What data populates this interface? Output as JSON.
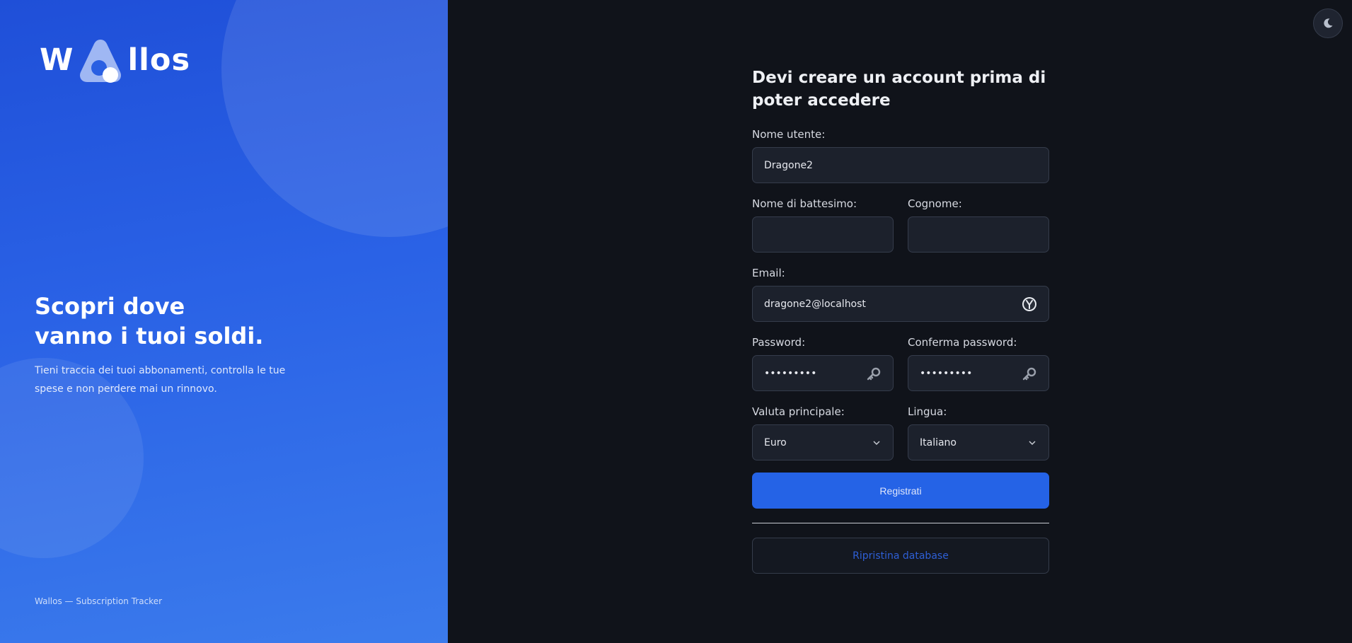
{
  "brand": {
    "logo_text": "llos",
    "logo_initial": "W",
    "accent": "#2563e6"
  },
  "hero": {
    "title_line1": "Scopri dove",
    "title_line2": "vanno i tuoi soldi.",
    "subtitle": "Tieni traccia dei tuoi abbonamenti, controlla le tue spese e non perdere mai un rinnovo.",
    "footer": "Wallos — Subscription Tracker"
  },
  "theme_toggle": {
    "icon": "moon-icon"
  },
  "form": {
    "title": "Devi creare un account prima di poter accedere",
    "username": {
      "label": "Nome utente:",
      "value": "Dragone2"
    },
    "first_name": {
      "label": "Nome di battesimo:",
      "value": ""
    },
    "last_name": {
      "label": "Cognome:",
      "value": ""
    },
    "email": {
      "label": "Email:",
      "value": "dragone2@localhost",
      "icon": "password-manager-icon"
    },
    "password": {
      "label": "Password:",
      "value": "•••••••••",
      "icon": "key-icon"
    },
    "confirm_password": {
      "label": "Conferma password:",
      "value": "•••••••••",
      "icon": "key-icon"
    },
    "currency": {
      "label": "Valuta principale:",
      "value": "Euro"
    },
    "language": {
      "label": "Lingua:",
      "value": "Italiano"
    },
    "register_label": "Registrati",
    "restore_label": "Ripristina database"
  }
}
